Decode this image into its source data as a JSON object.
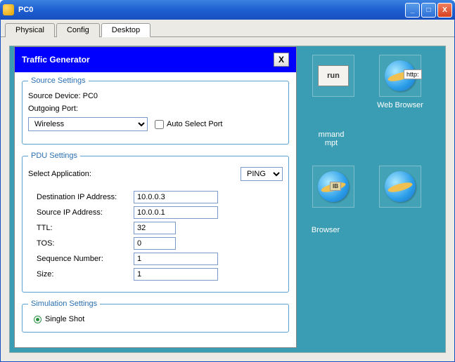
{
  "window": {
    "title": "PC0"
  },
  "tabs": {
    "physical": "Physical",
    "config": "Config",
    "desktop": "Desktop"
  },
  "desktop_icons": {
    "run": {
      "label": "run"
    },
    "web": {
      "label": "Web Browser",
      "tag": "http:"
    },
    "cmd": {
      "label": "mmand\nmpt"
    },
    "ib": {
      "label": "IB",
      "caption": "Browser"
    }
  },
  "dialog": {
    "title": "Traffic Generator",
    "close": "X",
    "source_settings": {
      "legend": "Source Settings",
      "device_label": "Source Device: PC0",
      "port_label": "Outgoing Port:",
      "port_value": "Wireless",
      "auto_label": "Auto Select Port"
    },
    "pdu": {
      "legend": "PDU Settings",
      "app_label": "Select Application:",
      "app_value": "PING",
      "fields": {
        "dest_label": "Destination IP Address:",
        "dest_val": "10.0.0.3",
        "src_label": "Source IP Address:",
        "src_val": "10.0.0.1",
        "ttl_label": "TTL:",
        "ttl_val": "32",
        "tos_label": "TOS:",
        "tos_val": "0",
        "seq_label": "Sequence Number:",
        "seq_val": "1",
        "size_label": "Size:",
        "size_val": "1"
      }
    },
    "sim": {
      "legend": "Simulation Settings",
      "single": "Single Shot"
    }
  }
}
